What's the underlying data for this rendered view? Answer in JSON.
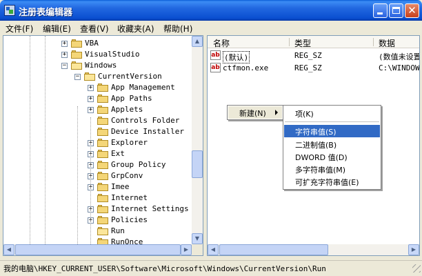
{
  "window": {
    "title": "注册表编辑器"
  },
  "menubar": [
    "文件(F)",
    "编辑(E)",
    "查看(V)",
    "收藏夹(A)",
    "帮助(H)"
  ],
  "tree": {
    "items": [
      {
        "label": "VBA",
        "level": 0,
        "expander": "+",
        "open": false
      },
      {
        "label": "VisualStudio",
        "level": 0,
        "expander": "+",
        "open": false
      },
      {
        "label": "Windows",
        "level": 0,
        "expander": "-",
        "open": true
      },
      {
        "label": "CurrentVersion",
        "level": 1,
        "expander": "-",
        "open": true
      },
      {
        "label": "App Management",
        "level": 2,
        "expander": "+",
        "open": false
      },
      {
        "label": "App Paths",
        "level": 2,
        "expander": "+",
        "open": false
      },
      {
        "label": "Applets",
        "level": 2,
        "expander": "+",
        "open": false
      },
      {
        "label": "Controls Folder",
        "level": 2,
        "expander": "",
        "open": false
      },
      {
        "label": "Device Installer",
        "level": 2,
        "expander": "",
        "open": false
      },
      {
        "label": "Explorer",
        "level": 2,
        "expander": "+",
        "open": false
      },
      {
        "label": "Ext",
        "level": 2,
        "expander": "+",
        "open": false
      },
      {
        "label": "Group Policy",
        "level": 2,
        "expander": "+",
        "open": false
      },
      {
        "label": "GrpConv",
        "level": 2,
        "expander": "+",
        "open": false
      },
      {
        "label": "Imee",
        "level": 2,
        "expander": "+",
        "open": false
      },
      {
        "label": "Internet",
        "level": 2,
        "expander": "",
        "open": false
      },
      {
        "label": "Internet Settings",
        "level": 2,
        "expander": "+",
        "open": false
      },
      {
        "label": "Policies",
        "level": 2,
        "expander": "+",
        "open": false
      },
      {
        "label": "Run",
        "level": 2,
        "expander": "",
        "open": true
      },
      {
        "label": "RunOnce",
        "level": 2,
        "expander": "",
        "open": false
      }
    ]
  },
  "list": {
    "columns": [
      "名称",
      "类型",
      "数据"
    ],
    "rows": [
      {
        "name": "(默认)",
        "type": "REG_SZ",
        "data": "(数值未设置)"
      },
      {
        "name": "ctfmon.exe",
        "type": "REG_SZ",
        "data": "C:\\WINDOWS\\"
      }
    ]
  },
  "context_menu": {
    "new_label": "新建(N)"
  },
  "submenu": {
    "key_label": "项(K)",
    "items": [
      "字符串值(S)",
      "二进制值(B)",
      "DWORD 值(D)",
      "多字符串值(M)",
      "可扩充字符串值(E)"
    ]
  },
  "status": {
    "path": "我的电脑\\HKEY_CURRENT_USER\\Software\\Microsoft\\Windows\\CurrentVersion\\Run"
  },
  "colors": {
    "title_blue": "#0a4fd0",
    "highlight": "#316ac5",
    "folder": "#f4d678"
  }
}
